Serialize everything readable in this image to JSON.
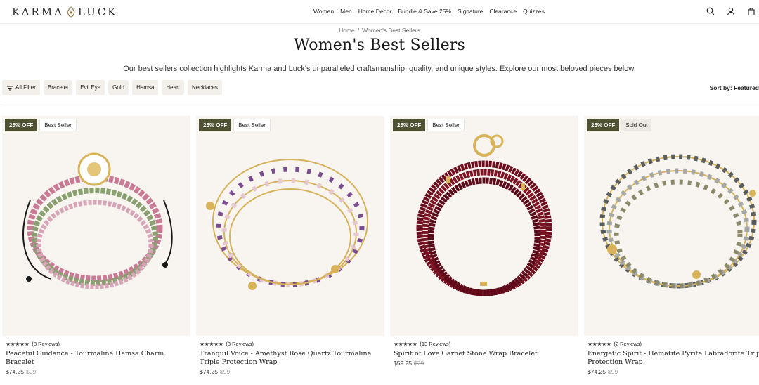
{
  "header": {
    "logo_left": "KARMA",
    "logo_right": "LUCK",
    "nav": [
      "Women",
      "Men",
      "Home Decor",
      "Bundle & Save 25%",
      "Signature",
      "Clearance",
      "Quizzes"
    ],
    "icons": [
      "search-icon",
      "account-icon",
      "cart-icon"
    ]
  },
  "breadcrumb": {
    "home": "Home",
    "separator": "/",
    "current": "Women's Best Sellers"
  },
  "page": {
    "title": "Women's Best Sellers",
    "subtitle": "Our best sellers collection highlights Karma and Luck's unparalleled craftsmanship, quality, and unique styles. Explore our most beloved pieces below."
  },
  "filters": {
    "all_label": "All Filter",
    "chips": [
      "Bracelet",
      "Evil Eye",
      "Gold",
      "Hamsa",
      "Heart",
      "Necklaces"
    ]
  },
  "sort": {
    "label": "Sort by:",
    "value": "Featured"
  },
  "products": [
    {
      "discount": "25% OFF",
      "tag": "Best Seller",
      "tag_type": "best",
      "stars": "★★★★★",
      "reviews": "(8 Reviews)",
      "name": "Peaceful Guidance - Tourmaline Hamsa Charm Bracelet",
      "price": "$74.25",
      "was": "$99"
    },
    {
      "discount": "25% OFF",
      "tag": "Best Seller",
      "tag_type": "best",
      "stars": "★★★★★",
      "reviews": "(3 Reviews)",
      "name": "Tranquil Voice - Amethyst Rose Quartz Tourmaline Triple Protection Wrap",
      "price": "$74.25",
      "was": "$99"
    },
    {
      "discount": "25% OFF",
      "tag": "Best Seller",
      "tag_type": "best",
      "stars": "★★★★★",
      "reviews": "(13 Reviews)",
      "name": "Spirit of Love Garnet Stone Wrap Bracelet",
      "price": "$59.25",
      "was": "$79"
    },
    {
      "discount": "25% OFF",
      "tag": "Sold Out",
      "tag_type": "sold",
      "stars": "★★★★★",
      "reviews": "(2 Reviews)",
      "name": "Energetic Spirit - Hematite Pyrite Labradorite Triple Protection Wrap",
      "price": "$74.25",
      "was": "$99"
    }
  ],
  "colors": {
    "badge_discount": "#4f5232",
    "image_bg": "#f8f5f1",
    "chip_bg": "#f3efea"
  }
}
